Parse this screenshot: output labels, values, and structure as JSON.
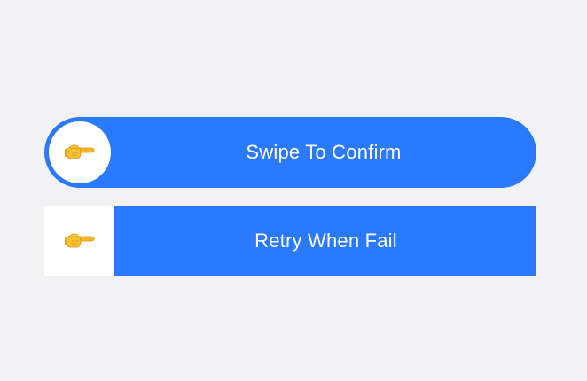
{
  "sliders": [
    {
      "label": "Swipe To Confirm",
      "icon": "pointing-hand-icon",
      "style": "pill"
    },
    {
      "label": "Retry When Fail",
      "icon": "pointing-hand-icon",
      "style": "rectangle"
    }
  ],
  "colors": {
    "background": "#f2f2f4",
    "track": "#2a79ff",
    "knob": "#ffffff",
    "label": "#ffffff",
    "icon": "#f5b71f"
  }
}
